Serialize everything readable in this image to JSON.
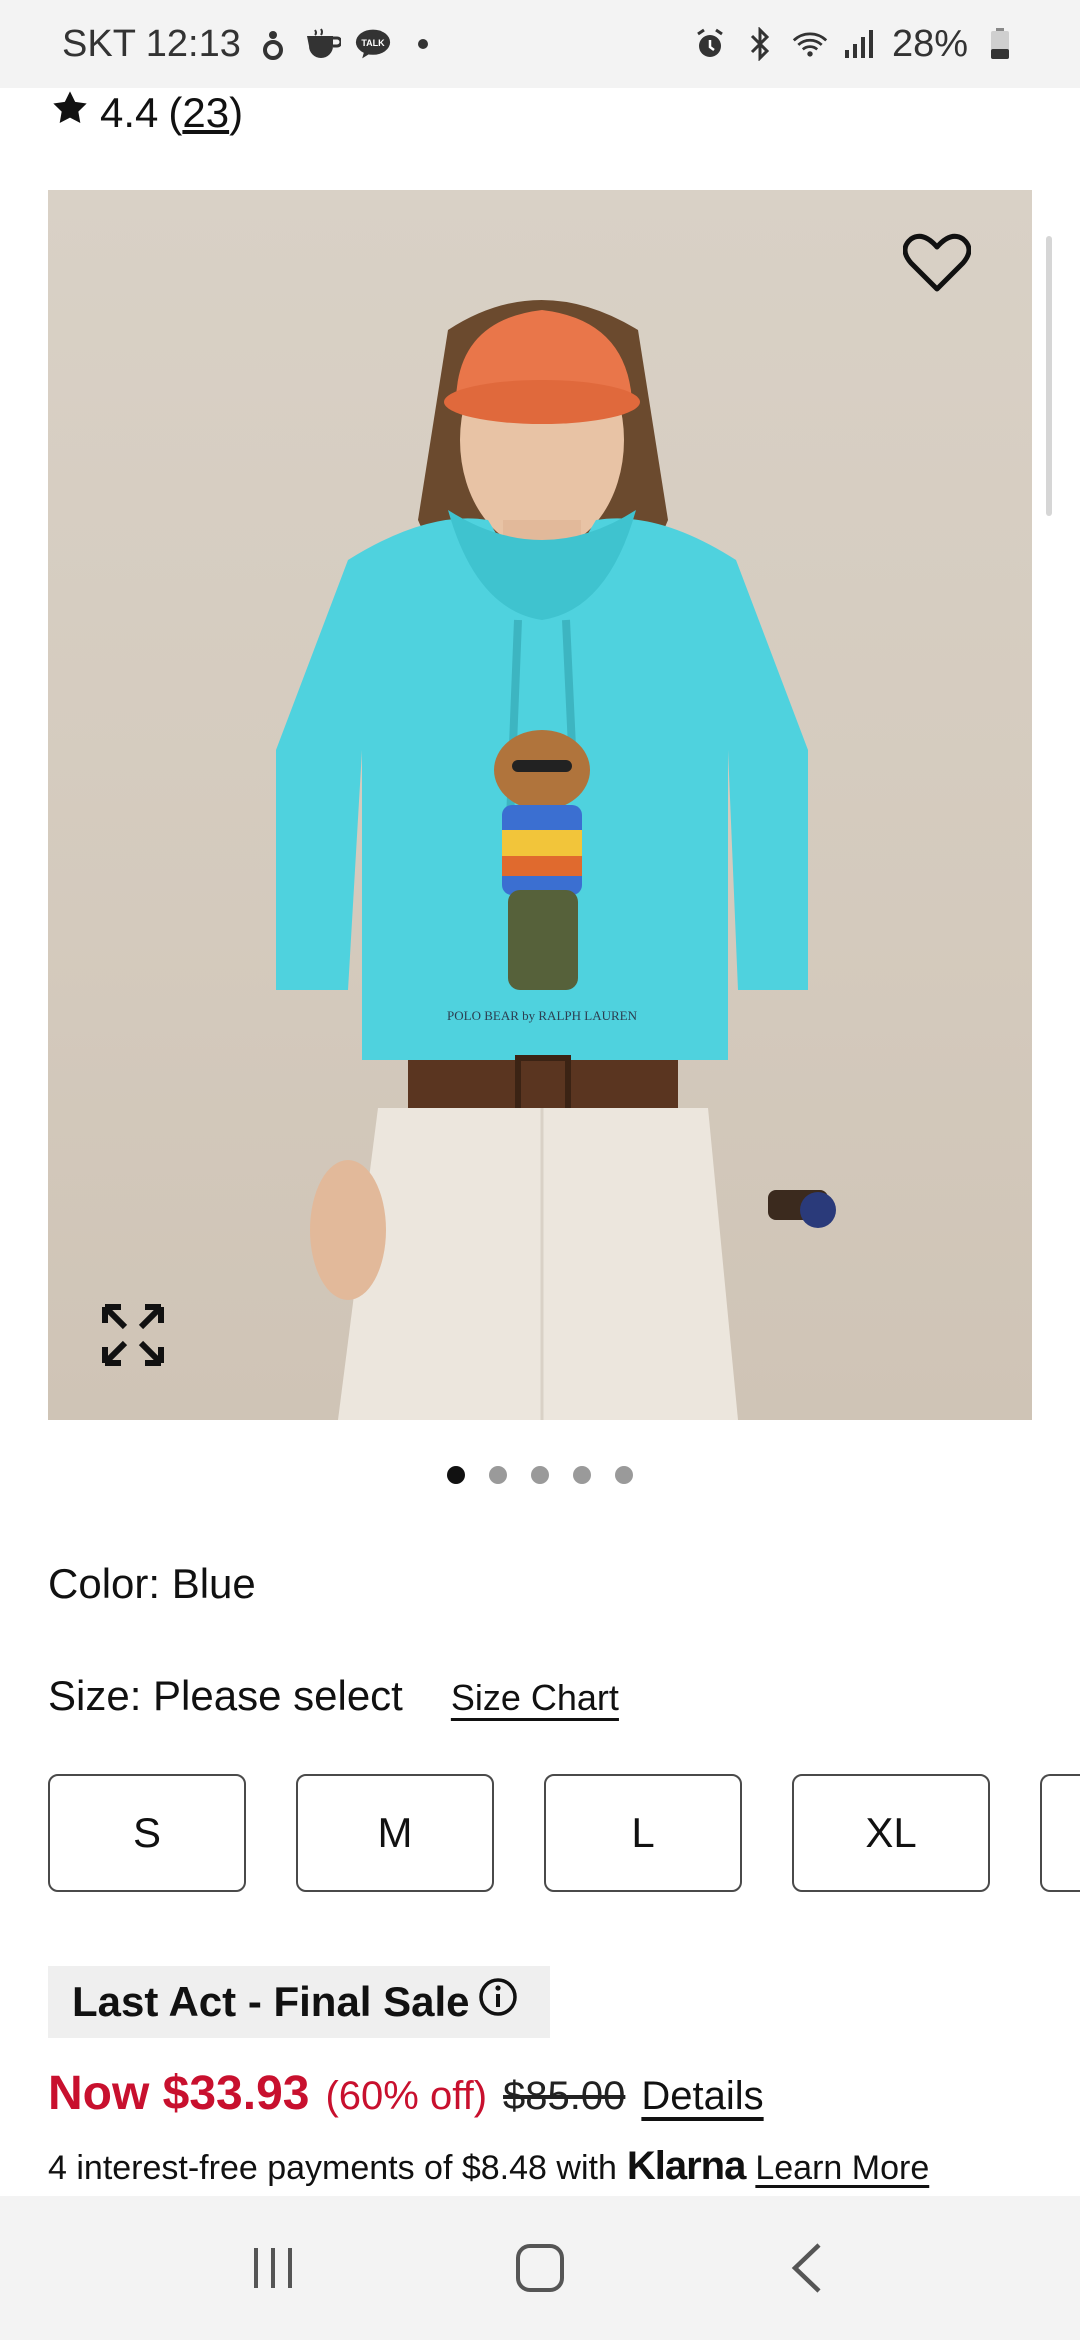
{
  "status_bar": {
    "carrier_time": "SKT 12:13",
    "battery": "28%",
    "notification_icons": [
      "person-icon",
      "coffee-icon",
      "talk-icon",
      "dot-icon"
    ],
    "system_icons": [
      "alarm-icon",
      "bluetooth-icon",
      "wifi-icon",
      "signal-icon",
      "battery-icon"
    ],
    "talk_badge": "TALK"
  },
  "rating": {
    "value": "4.4",
    "open_paren": "(",
    "count": "23",
    "close_paren": ")"
  },
  "product_image": {
    "alt": "Model wearing turquoise hoodie",
    "carousel_index": 1,
    "carousel_total": 5
  },
  "color": {
    "label": "Color: Blue"
  },
  "size": {
    "label": "Size: Please select",
    "chart_link": "Size Chart",
    "options": [
      "S",
      "M",
      "L",
      "XL"
    ]
  },
  "sale": {
    "badge": "Last Act - Final Sale",
    "now_price": "Now $33.93",
    "discount": "(60% off)",
    "original_price": "$85.00",
    "details_link": "Details"
  },
  "klarna": {
    "text": "4 interest-free payments of $8.48 with",
    "brand": "Klarna",
    "learn_more": "Learn More"
  },
  "colors": {
    "sale_red": "#c8102e",
    "hoodie": "#4fd2de",
    "cap": "#e9764a"
  }
}
